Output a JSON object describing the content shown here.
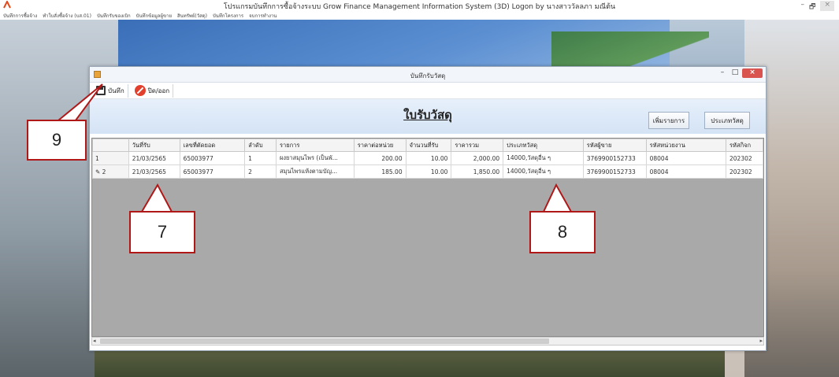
{
  "app": {
    "title": "โปรแกรมบันทึกการซื้อจ้างระบบ Grow Finance Management Information System (3D) Logon by นางสาววัลลภา มณีต้น",
    "menu": [
      "บันทึกการซื้อจ้าง",
      "ทำใบสั่งซื้อจ้าง (บส.01)",
      "บันทึกรับของเบิก",
      "บันทึกข้อมูลผู้ขาย",
      "สินทรัพย์(วัสดุ)",
      "บันทึกโครงการ",
      "จบการทำงาน"
    ],
    "controls": {
      "minimize": "–",
      "restore": "🗗",
      "close": "×"
    }
  },
  "window": {
    "title": "บันทึกรับวัสดุ",
    "controls": {
      "minimize": "–",
      "maximize": "□",
      "close": "×"
    }
  },
  "toolbar": {
    "save_label": "บันทึก",
    "close_label": "ปิด/ออก"
  },
  "form": {
    "heading": "ใบรับวัสดุ",
    "add_item_label": "เพิ่มรายการ",
    "material_type_label": "ประเภทวัสดุ"
  },
  "table": {
    "columns": [
      "",
      "วันที่รับ",
      "เลขที่ตัดยอด",
      "ลำดับ",
      "รายการ",
      "ราคาต่อหน่วย",
      "จำนวนที่รับ",
      "ราคารวม",
      "ประเภทวัสดุ",
      "รหัสผู้ขาย",
      "รหัสหน่วยงาน",
      "รหัสกิจก"
    ],
    "rows": [
      {
        "marker": "1",
        "date": "21/03/2565",
        "ref_no": "65003977",
        "seq": "1",
        "item": "ผงยาสมุนไพร (เป็นพั...",
        "unit_price": "200.00",
        "qty": "10.00",
        "total": "2,000.00",
        "type": "14000,วัสดุอื่น ๆ",
        "vendor": "3769900152733",
        "dept": "08004",
        "activity": "202302"
      },
      {
        "marker": "✎ 2",
        "date": "21/03/2565",
        "ref_no": "65003977",
        "seq": "2",
        "item": "สมุนไพรแห้งตามบัญ...",
        "unit_price": "185.00",
        "qty": "10.00",
        "total": "1,850.00",
        "type": "14000,วัสดุอื่น ๆ",
        "vendor": "3769900152733",
        "dept": "08004",
        "activity": "202302"
      }
    ]
  },
  "callouts": [
    "9",
    "7",
    "8"
  ],
  "colors": {
    "callout_border": "#b01818",
    "close_button": "#d9534f"
  }
}
